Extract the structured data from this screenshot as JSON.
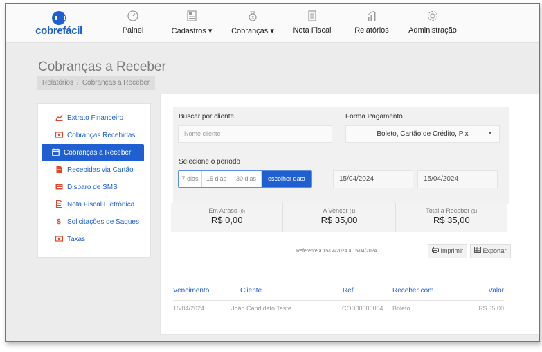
{
  "brand": {
    "name": "cobrefácil"
  },
  "nav": {
    "items": [
      {
        "label": "Painel",
        "icon": "speedometer-icon"
      },
      {
        "label": "Cadastros ▾",
        "icon": "id-card-icon"
      },
      {
        "label": "Cobranças ▾",
        "icon": "money-bag-icon"
      },
      {
        "label": "Nota Fiscal",
        "icon": "document-icon"
      },
      {
        "label": "Relatórios",
        "icon": "bar-chart-icon"
      },
      {
        "label": "Administração",
        "icon": "gear-icon"
      }
    ]
  },
  "page": {
    "title": "Cobranças a Receber",
    "breadcrumb": [
      "Relatórios",
      "Cobranças a Receber"
    ]
  },
  "sidebar": {
    "items": [
      {
        "label": "Extrato Financeiro",
        "icon": "line-chart-icon"
      },
      {
        "label": "Cobranças Recebidas",
        "icon": "money-icon"
      },
      {
        "label": "Cobranças a Receber",
        "icon": "calendar-icon",
        "active": true
      },
      {
        "label": "Recebidas via Cartão",
        "icon": "file-icon"
      },
      {
        "label": "Disparo de SMS",
        "icon": "sms-icon"
      },
      {
        "label": "Nota Fiscal Eletrônica",
        "icon": "invoice-icon"
      },
      {
        "label": "Solicitações de Saques",
        "icon": "dollar-icon"
      },
      {
        "label": "Taxas",
        "icon": "money-icon"
      }
    ]
  },
  "filters": {
    "client_label": "Buscar por cliente",
    "client_placeholder": "Nome cliente",
    "payment_label": "Forma Pagamento",
    "payment_value": "Boleto, Cartão de Crédito, Pix",
    "period_label": "Selecione o período",
    "period_options": [
      "7 dias",
      "15 dias",
      "30 dias",
      "escolher data"
    ],
    "period_selected": "escolher data",
    "date_start": "15/04/2024",
    "date_end": "15/04/2024"
  },
  "summary": [
    {
      "label": "Em Atraso",
      "count": "(0)",
      "value": "R$ 0,00"
    },
    {
      "label": "A Vencer",
      "count": "(1)",
      "value": "R$ 35,00"
    },
    {
      "label": "Total a Receber",
      "count": "(1)",
      "value": "R$ 35,00"
    }
  ],
  "report": {
    "reference": "Referente a 15/04/2024 a 15/04/2024",
    "print_label": "Imprimir",
    "export_label": "Exportar"
  },
  "table": {
    "headers": [
      "Vencimento",
      "Cliente",
      "Ref",
      "Receber com",
      "Valor"
    ],
    "rows": [
      [
        "15/04/2024",
        "João Candidato Teste",
        "COB00000004",
        "Boleto",
        "R$ 35,00"
      ]
    ]
  },
  "colors": {
    "primary": "#1f5fd1",
    "accent_icon": "#e2462a",
    "frame_border": "#3d7dd8"
  }
}
